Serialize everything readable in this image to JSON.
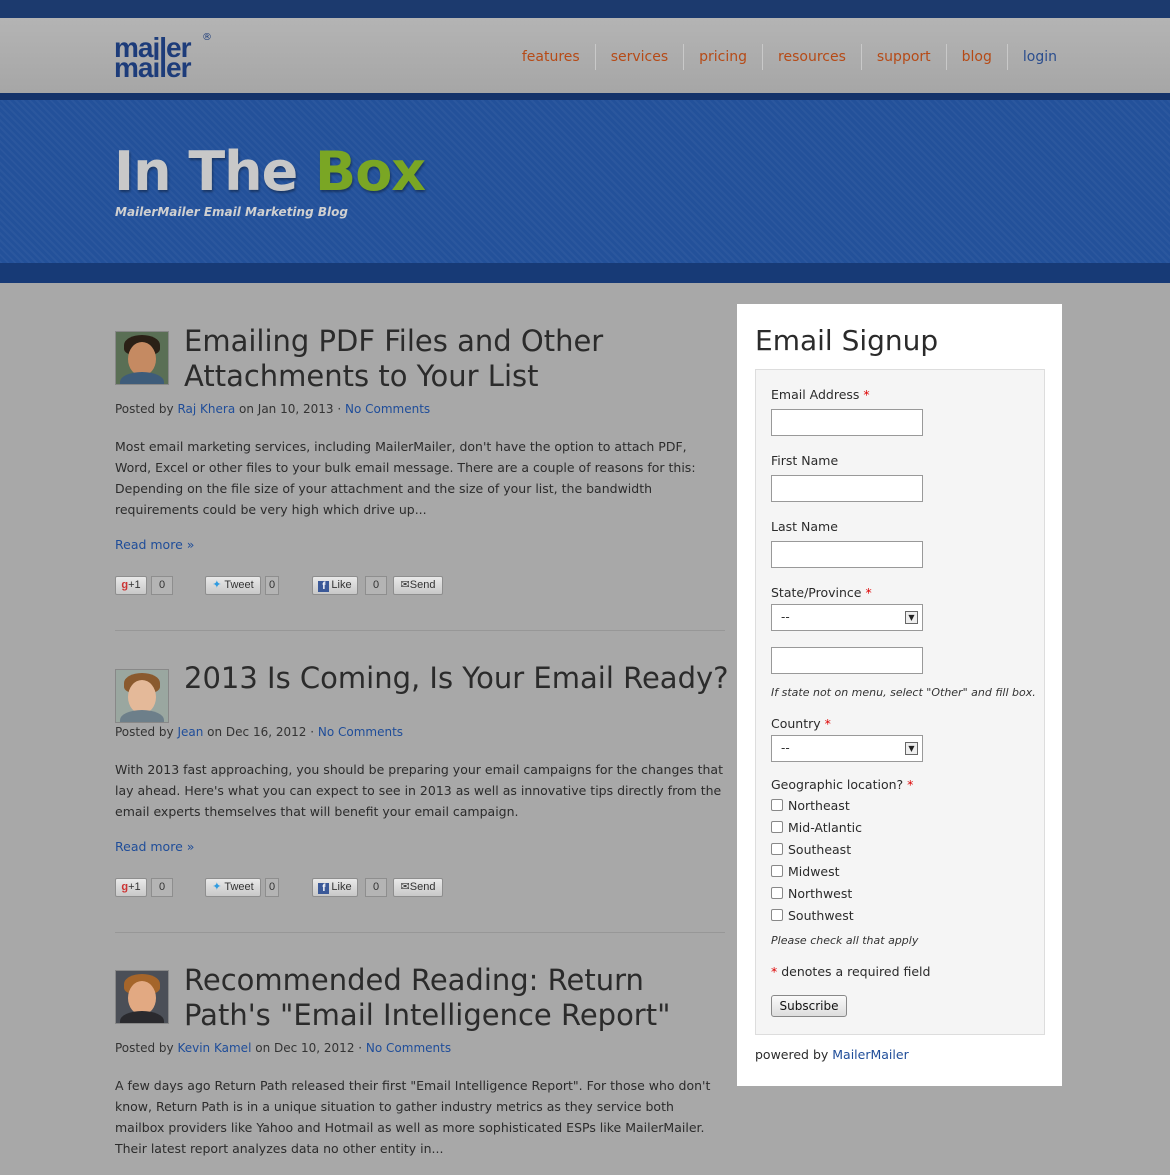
{
  "header": {
    "logo_top": "mailer",
    "logo_bottom": "mailer",
    "logo_reg": "®",
    "nav": [
      "features",
      "services",
      "pricing",
      "resources",
      "support",
      "blog",
      "login"
    ]
  },
  "banner": {
    "title_part1": "In The ",
    "title_part2": "Box",
    "subtitle": "MailerMailer Email Marketing Blog"
  },
  "posts": [
    {
      "title": "Emailing PDF Files and Other Attachments to Your List",
      "posted_by": "Posted by ",
      "author": "Raj Khera",
      "date": " on Jan 10, 2013 · ",
      "comments": "No Comments",
      "excerpt": "Most email marketing services, including MailerMailer, don't have the option to attach PDF, Word, Excel or other files to your bulk email message. There are a couple of reasons for this: Depending on the file size of your attachment and the size of your list, the bandwidth requirements could be very high which drive up...",
      "read_more": "Read more »",
      "gplus": "+1",
      "gplus_count": "0",
      "tweet": "Tweet",
      "tweet_count": "0",
      "like": "Like",
      "like_count": "0",
      "send": "Send"
    },
    {
      "title": "2013 Is Coming, Is Your Email Ready?",
      "posted_by": "Posted by ",
      "author": "Jean",
      "date": " on Dec 16, 2012 · ",
      "comments": "No Comments",
      "excerpt": "With 2013 fast approaching, you should be preparing your email campaigns for the changes that lay ahead. Here's what you can expect to see in 2013 as well as innovative tips directly from the email experts themselves that will benefit your email campaign.",
      "read_more": "Read more »",
      "gplus": "+1",
      "gplus_count": "0",
      "tweet": "Tweet",
      "tweet_count": "0",
      "like": "Like",
      "like_count": "0",
      "send": "Send"
    },
    {
      "title": "Recommended Reading: Return Path's \"Email Intelligence Report\"",
      "posted_by": "Posted by ",
      "author": "Kevin Kamel",
      "date": " on Dec 10, 2012 · ",
      "comments": "No Comments",
      "excerpt": "A few days ago Return Path released their first \"Email Intelligence Report\". For those who don't know, Return Path is in a unique situation to gather industry metrics as they service both mailbox providers like Yahoo and Hotmail as well as more sophisticated ESPs like MailerMailer. Their latest report analyzes data no other entity in..."
    }
  ],
  "signup": {
    "title": "Email Signup",
    "email_label": "Email Address",
    "first_name_label": "First Name",
    "last_name_label": "Last Name",
    "state_label": "State/Province",
    "state_value": "--",
    "state_hint": "If state not on menu, select \"Other\" and fill box.",
    "country_label": "Country",
    "country_value": "--",
    "geo_label": "Geographic location?",
    "regions": [
      "Northeast",
      "Mid-Atlantic",
      "Southeast",
      "Midwest",
      "Northwest",
      "Southwest"
    ],
    "check_hint": "Please check all that apply",
    "required_marker": "*",
    "required_note": " denotes a required field",
    "subscribe": "Subscribe",
    "powered_by": "powered by ",
    "powered_link": "MailerMailer"
  }
}
